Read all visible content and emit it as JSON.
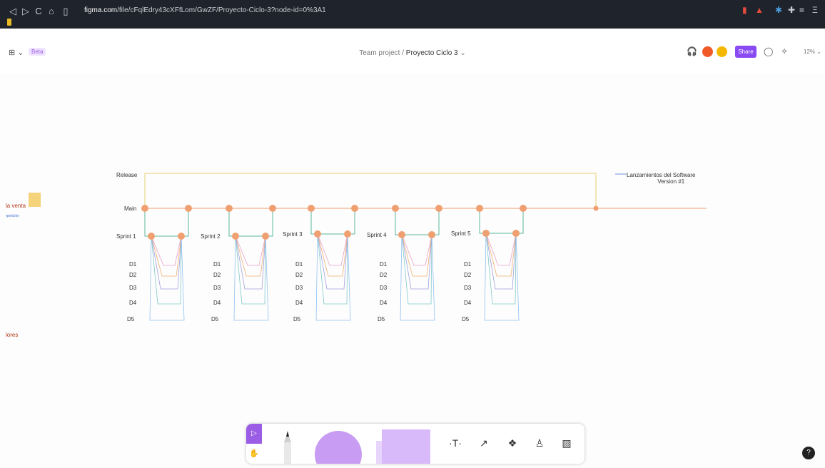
{
  "browser": {
    "nav_icons": [
      "◁",
      "▷",
      "C",
      "⌂",
      "▯"
    ],
    "url_domain": "figma.com",
    "url_path": "/file/cFqlEdry43cXFfLom/GwZF/Proyecto-Ciclo-3?node-id=0%3A1",
    "extension_icons": [
      "▮",
      "▲",
      "✱",
      "✚",
      "≡",
      "Ξ"
    ]
  },
  "figma_toolbar": {
    "menu_icon": "⊞ ⌄",
    "beta_label": "Beta",
    "breadcrumb_parent": "Team project",
    "breadcrumb_separator": "/",
    "breadcrumb_current": "Proyecto Ciclo 3",
    "breadcrumb_chevron": "⌄",
    "share_label": "Share",
    "avatar_colors": [
      "#f05a28",
      "#f5b800"
    ],
    "zoom_label": "12% ⌄"
  },
  "canvas": {
    "release_label": "Release",
    "main_label": "Main",
    "release_note_line1": "Lanzamientos del Software",
    "release_note_line2": "Version #1",
    "side_label_1": "la venta",
    "side_label_2": "rpetición",
    "side_label_3": "lores",
    "sprints": [
      {
        "label": "Sprint 1",
        "days": [
          "D1",
          "D2",
          "D3",
          "D4",
          "D5"
        ]
      },
      {
        "label": "Sprint 2",
        "days": [
          "D1",
          "D2",
          "D3",
          "D4",
          "D5"
        ]
      },
      {
        "label": "Sprint 3",
        "days": [
          "D1",
          "D2",
          "D3",
          "D4",
          "D5"
        ]
      },
      {
        "label": "Sprint 4",
        "days": [
          "D1",
          "D2",
          "D3",
          "D4",
          "D5"
        ]
      },
      {
        "label": "Sprint 5",
        "days": [
          "D1",
          "D2",
          "D3",
          "D4",
          "D5"
        ]
      }
    ],
    "colors": {
      "node": "#f0a070",
      "main_line": "#f0a070",
      "release_line": "#e8d070",
      "sprint_line": "#5cb89a",
      "day_colors": [
        "#e8a0c8",
        "#f0b070",
        "#a0a0e0",
        "#80c8c8",
        "#90c0f0"
      ]
    }
  },
  "bottom_toolbar": {
    "select_icon": "▷",
    "hand_icon": "✋",
    "text_icon": "·T·",
    "connector_icon": "↗",
    "component_icon": "❖",
    "stamp_icon": "♙",
    "image_icon": "▨"
  },
  "help_label": "?"
}
